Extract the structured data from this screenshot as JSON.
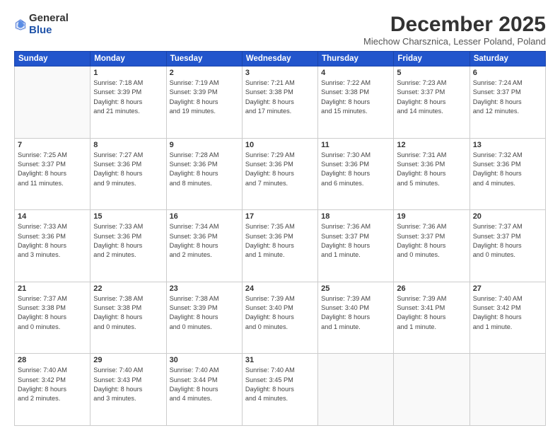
{
  "logo": {
    "general": "General",
    "blue": "Blue"
  },
  "title": "December 2025",
  "subtitle": "Miechow Charsznica, Lesser Poland, Poland",
  "days": [
    "Sunday",
    "Monday",
    "Tuesday",
    "Wednesday",
    "Thursday",
    "Friday",
    "Saturday"
  ],
  "weeks": [
    [
      {
        "day": "",
        "info": ""
      },
      {
        "day": "1",
        "info": "Sunrise: 7:18 AM\nSunset: 3:39 PM\nDaylight: 8 hours\nand 21 minutes."
      },
      {
        "day": "2",
        "info": "Sunrise: 7:19 AM\nSunset: 3:39 PM\nDaylight: 8 hours\nand 19 minutes."
      },
      {
        "day": "3",
        "info": "Sunrise: 7:21 AM\nSunset: 3:38 PM\nDaylight: 8 hours\nand 17 minutes."
      },
      {
        "day": "4",
        "info": "Sunrise: 7:22 AM\nSunset: 3:38 PM\nDaylight: 8 hours\nand 15 minutes."
      },
      {
        "day": "5",
        "info": "Sunrise: 7:23 AM\nSunset: 3:37 PM\nDaylight: 8 hours\nand 14 minutes."
      },
      {
        "day": "6",
        "info": "Sunrise: 7:24 AM\nSunset: 3:37 PM\nDaylight: 8 hours\nand 12 minutes."
      }
    ],
    [
      {
        "day": "7",
        "info": "Sunrise: 7:25 AM\nSunset: 3:37 PM\nDaylight: 8 hours\nand 11 minutes."
      },
      {
        "day": "8",
        "info": "Sunrise: 7:27 AM\nSunset: 3:36 PM\nDaylight: 8 hours\nand 9 minutes."
      },
      {
        "day": "9",
        "info": "Sunrise: 7:28 AM\nSunset: 3:36 PM\nDaylight: 8 hours\nand 8 minutes."
      },
      {
        "day": "10",
        "info": "Sunrise: 7:29 AM\nSunset: 3:36 PM\nDaylight: 8 hours\nand 7 minutes."
      },
      {
        "day": "11",
        "info": "Sunrise: 7:30 AM\nSunset: 3:36 PM\nDaylight: 8 hours\nand 6 minutes."
      },
      {
        "day": "12",
        "info": "Sunrise: 7:31 AM\nSunset: 3:36 PM\nDaylight: 8 hours\nand 5 minutes."
      },
      {
        "day": "13",
        "info": "Sunrise: 7:32 AM\nSunset: 3:36 PM\nDaylight: 8 hours\nand 4 minutes."
      }
    ],
    [
      {
        "day": "14",
        "info": "Sunrise: 7:33 AM\nSunset: 3:36 PM\nDaylight: 8 hours\nand 3 minutes."
      },
      {
        "day": "15",
        "info": "Sunrise: 7:33 AM\nSunset: 3:36 PM\nDaylight: 8 hours\nand 2 minutes."
      },
      {
        "day": "16",
        "info": "Sunrise: 7:34 AM\nSunset: 3:36 PM\nDaylight: 8 hours\nand 2 minutes."
      },
      {
        "day": "17",
        "info": "Sunrise: 7:35 AM\nSunset: 3:36 PM\nDaylight: 8 hours\nand 1 minute."
      },
      {
        "day": "18",
        "info": "Sunrise: 7:36 AM\nSunset: 3:37 PM\nDaylight: 8 hours\nand 1 minute."
      },
      {
        "day": "19",
        "info": "Sunrise: 7:36 AM\nSunset: 3:37 PM\nDaylight: 8 hours\nand 0 minutes."
      },
      {
        "day": "20",
        "info": "Sunrise: 7:37 AM\nSunset: 3:37 PM\nDaylight: 8 hours\nand 0 minutes."
      }
    ],
    [
      {
        "day": "21",
        "info": "Sunrise: 7:37 AM\nSunset: 3:38 PM\nDaylight: 8 hours\nand 0 minutes."
      },
      {
        "day": "22",
        "info": "Sunrise: 7:38 AM\nSunset: 3:38 PM\nDaylight: 8 hours\nand 0 minutes."
      },
      {
        "day": "23",
        "info": "Sunrise: 7:38 AM\nSunset: 3:39 PM\nDaylight: 8 hours\nand 0 minutes."
      },
      {
        "day": "24",
        "info": "Sunrise: 7:39 AM\nSunset: 3:40 PM\nDaylight: 8 hours\nand 0 minutes."
      },
      {
        "day": "25",
        "info": "Sunrise: 7:39 AM\nSunset: 3:40 PM\nDaylight: 8 hours\nand 1 minute."
      },
      {
        "day": "26",
        "info": "Sunrise: 7:39 AM\nSunset: 3:41 PM\nDaylight: 8 hours\nand 1 minute."
      },
      {
        "day": "27",
        "info": "Sunrise: 7:40 AM\nSunset: 3:42 PM\nDaylight: 8 hours\nand 1 minute."
      }
    ],
    [
      {
        "day": "28",
        "info": "Sunrise: 7:40 AM\nSunset: 3:42 PM\nDaylight: 8 hours\nand 2 minutes."
      },
      {
        "day": "29",
        "info": "Sunrise: 7:40 AM\nSunset: 3:43 PM\nDaylight: 8 hours\nand 3 minutes."
      },
      {
        "day": "30",
        "info": "Sunrise: 7:40 AM\nSunset: 3:44 PM\nDaylight: 8 hours\nand 4 minutes."
      },
      {
        "day": "31",
        "info": "Sunrise: 7:40 AM\nSunset: 3:45 PM\nDaylight: 8 hours\nand 4 minutes."
      },
      {
        "day": "",
        "info": ""
      },
      {
        "day": "",
        "info": ""
      },
      {
        "day": "",
        "info": ""
      }
    ]
  ]
}
